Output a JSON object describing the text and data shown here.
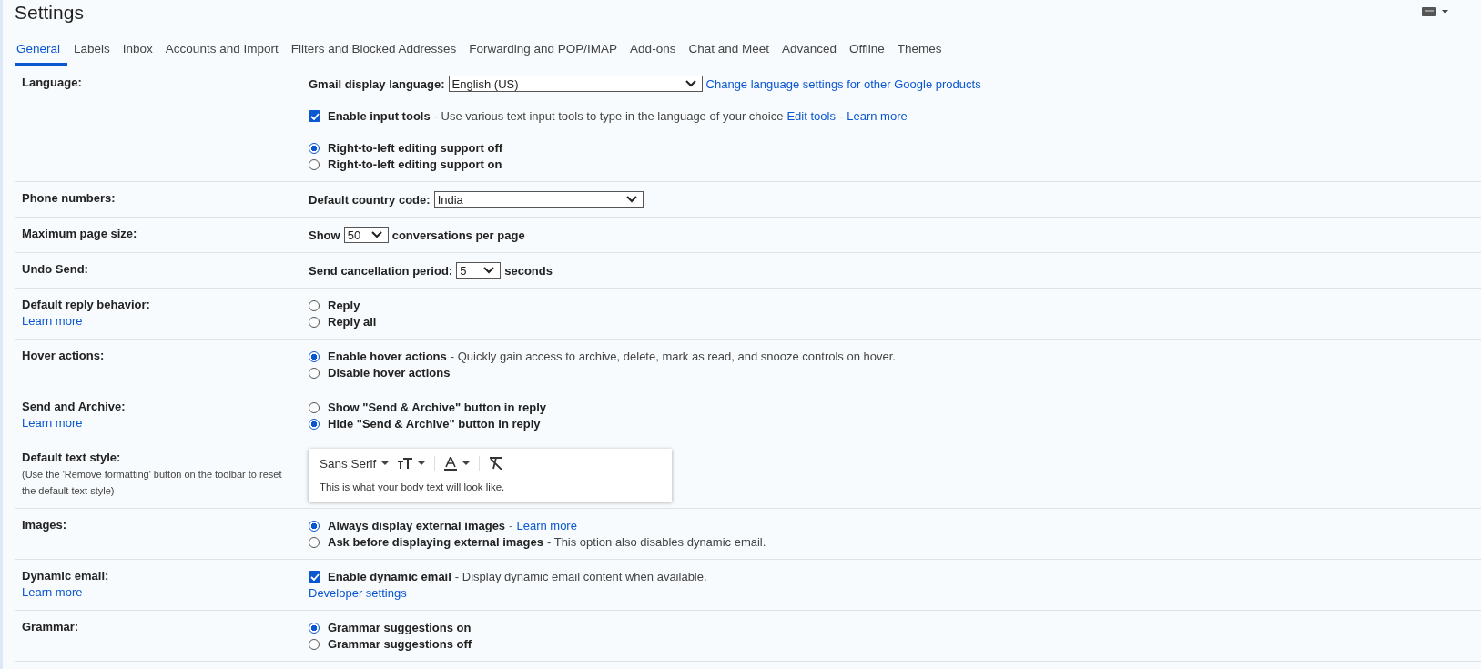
{
  "title": "Settings",
  "tabs": [
    {
      "label": "General",
      "selected": true
    },
    {
      "label": "Labels",
      "selected": false
    },
    {
      "label": "Inbox",
      "selected": false
    },
    {
      "label": "Accounts and Import",
      "selected": false
    },
    {
      "label": "Filters and Blocked Addresses",
      "selected": false
    },
    {
      "label": "Forwarding and POP/IMAP",
      "selected": false
    },
    {
      "label": "Add-ons",
      "selected": false
    },
    {
      "label": "Chat and Meet",
      "selected": false
    },
    {
      "label": "Advanced",
      "selected": false
    },
    {
      "label": "Offline",
      "selected": false
    },
    {
      "label": "Themes",
      "selected": false
    }
  ],
  "sections": [
    {
      "label": "Language:",
      "groups": [
        [
          {
            "kind": "select",
            "label": "Gmail display language:",
            "value": "English (US)",
            "links": [
              {
                "text": "Change language settings for other Google products"
              }
            ]
          }
        ],
        [
          {
            "kind": "check",
            "checked": true,
            "label": "Enable input tools",
            "description": "- Use various text input tools to type in the language of your choice",
            "links": [
              {
                "text": "Edit tools"
              },
              {
                "sep": "-",
                "text": "Learn more"
              }
            ]
          }
        ],
        [
          {
            "kind": "radio",
            "selected": true,
            "label": "Right-to-left editing support off"
          },
          {
            "kind": "radio",
            "selected": false,
            "label": "Right-to-left editing support on"
          }
        ]
      ]
    },
    {
      "label": "Phone numbers:",
      "groups": [
        [
          {
            "kind": "select",
            "label": "Default country code:",
            "value": "India"
          }
        ]
      ]
    },
    {
      "label": "Maximum page size:",
      "groups": [
        [
          {
            "kind": "select",
            "label": "Show",
            "value": "50",
            "after": "conversations per page"
          }
        ]
      ]
    },
    {
      "label": "Undo Send:",
      "groups": [
        [
          {
            "kind": "select",
            "label": "Send cancellation period:",
            "value": "5",
            "after": "seconds"
          }
        ]
      ]
    },
    {
      "label": "Default reply behavior:",
      "link": "Learn more",
      "groups": [
        [
          {
            "kind": "radio",
            "selected": false,
            "label": "Reply"
          },
          {
            "kind": "radio",
            "selected": false,
            "label": "Reply all"
          }
        ]
      ]
    },
    {
      "label": "Hover actions:",
      "groups": [
        [
          {
            "kind": "radio",
            "selected": true,
            "label": "Enable hover actions",
            "description": "- Quickly gain access to archive, delete, mark as read, and snooze controls on hover."
          },
          {
            "kind": "radio",
            "selected": false,
            "label": "Disable hover actions"
          }
        ]
      ]
    },
    {
      "label": "Send and Archive:",
      "link": "Learn more",
      "groups": [
        [
          {
            "kind": "radio",
            "selected": false,
            "label": "Show \"Send & Archive\" button in reply"
          },
          {
            "kind": "radio",
            "selected": true,
            "label": "Hide \"Send & Archive\" button in reply"
          }
        ]
      ]
    },
    {
      "label": "Default text style:",
      "note": "(Use the 'Remove formatting' button on the toolbar to reset the default text style)",
      "groups": [
        [
          {
            "kind": "style",
            "font": "Sans Serif",
            "preview": "This is what your body text will look like."
          }
        ]
      ]
    },
    {
      "label": "Images:",
      "groups": [
        [
          {
            "kind": "radio",
            "selected": true,
            "label": "Always display external images",
            "links": [
              {
                "sep": "-",
                "text": "Learn more"
              }
            ]
          },
          {
            "kind": "radio",
            "selected": false,
            "label": "Ask before displaying external images",
            "description": "- This option also disables dynamic email."
          }
        ]
      ]
    },
    {
      "label": "Dynamic email:",
      "link": "Learn more",
      "groups": [
        [
          {
            "kind": "check",
            "checked": true,
            "label": "Enable dynamic email",
            "description": "- Display dynamic email content when available."
          },
          {
            "kind": "link",
            "text": "Developer settings"
          }
        ]
      ]
    },
    {
      "label": "Grammar:",
      "groups": [
        [
          {
            "kind": "radio",
            "selected": true,
            "label": "Grammar suggestions on"
          },
          {
            "kind": "radio",
            "selected": false,
            "label": "Grammar suggestions off"
          }
        ]
      ]
    }
  ]
}
